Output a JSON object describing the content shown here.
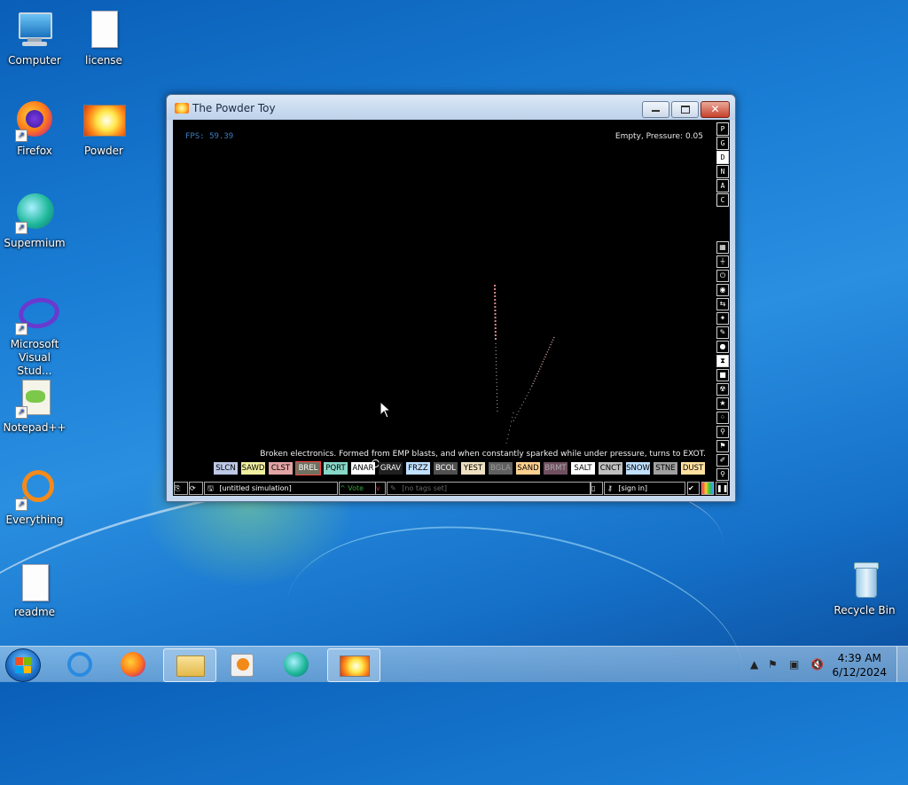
{
  "desktop": {
    "icons": [
      {
        "label": "Computer"
      },
      {
        "label": "license"
      },
      {
        "label": "Firefox"
      },
      {
        "label": "Powder"
      },
      {
        "label": "Supermium"
      },
      {
        "label": "Microsoft Visual Stud..."
      },
      {
        "label": "Notepad++"
      },
      {
        "label": "Everything"
      },
      {
        "label": "readme"
      },
      {
        "label": "Recycle Bin"
      }
    ]
  },
  "window": {
    "title": "The Powder Toy",
    "fps": "FPS: 59.39",
    "status": "Empty, Pressure: 0.05",
    "render_modes": [
      "P",
      "G",
      "D",
      "N",
      "A",
      "C"
    ],
    "selected_render_mode": "D",
    "description": "Broken electronics. Formed from EMP blasts, and when constantly sparked while under pressure, turns to EXOT.",
    "elements": [
      {
        "name": "SLCN",
        "color": "#bcc8e6",
        "text": "#000"
      },
      {
        "name": "SAWD",
        "color": "#f0f0a0",
        "text": "#000"
      },
      {
        "name": "CLST",
        "color": "#e4a4a4",
        "text": "#000"
      },
      {
        "name": "BREL",
        "color": "#707060",
        "text": "#fff",
        "selected": true
      },
      {
        "name": "PQRT",
        "color": "#88d8c8",
        "text": "#000"
      },
      {
        "name": "ANAR",
        "color": "#ffffff",
        "text": "#000"
      },
      {
        "name": "GRAV",
        "color": "#202020",
        "text": "#fff"
      },
      {
        "name": "FRZZ",
        "color": "#c0e0ff",
        "text": "#000"
      },
      {
        "name": "BCOL",
        "color": "#505050",
        "text": "#fff"
      },
      {
        "name": "YEST",
        "color": "#eee0c0",
        "text": "#000"
      },
      {
        "name": "BGLA",
        "color": "#606060",
        "text": "#999"
      },
      {
        "name": "SAND",
        "color": "#ffd090",
        "text": "#000"
      },
      {
        "name": "BRMT",
        "color": "#705060",
        "text": "#aaa"
      },
      {
        "name": "SALT",
        "color": "#ffffff",
        "text": "#000"
      },
      {
        "name": "CNCT",
        "color": "#c0c0c0",
        "text": "#000"
      },
      {
        "name": "SNOW",
        "color": "#c0e0ff",
        "text": "#000"
      },
      {
        "name": "STNE",
        "color": "#a0a0a0",
        "text": "#000"
      },
      {
        "name": "DUST",
        "color": "#ffe0a0",
        "text": "#000"
      }
    ],
    "bottom_bar": {
      "sim_name": "[untitled simulation]",
      "vote": "Vote",
      "tags": "[no tags set]",
      "sign_in": "[sign in]"
    }
  },
  "taskbar": {
    "time": "4:39 AM",
    "date": "6/12/2024"
  }
}
